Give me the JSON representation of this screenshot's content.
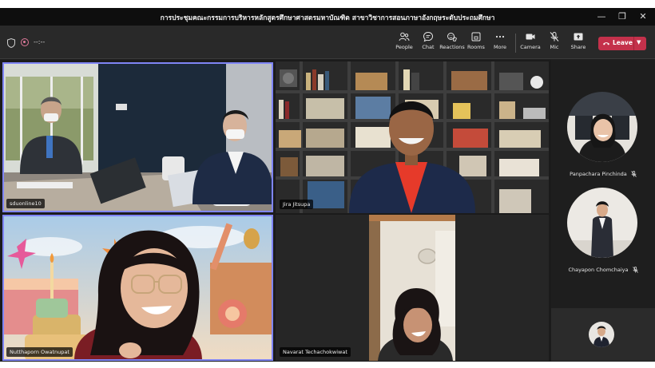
{
  "window": {
    "title": "การประชุมคณะกรรมการบริหารหลักสูตรศึกษาศาสตรมหาบัณฑิต สาขาวิชาการสอนภาษาอังกฤษระดับประถมศึกษา",
    "controls": {
      "minimize": "—",
      "maximize": "❐",
      "close": "✕"
    }
  },
  "toolbar": {
    "timer": "--:--",
    "buttons": [
      {
        "label": "People",
        "icon": "people-icon"
      },
      {
        "label": "Chat",
        "icon": "chat-icon"
      },
      {
        "label": "Reactions",
        "icon": "reactions-icon"
      },
      {
        "label": "Rooms",
        "icon": "rooms-icon"
      },
      {
        "label": "More",
        "icon": "more-icon"
      },
      {
        "label": "Camera",
        "icon": "camera-icon"
      },
      {
        "label": "Mic",
        "icon": "mic-off-icon"
      },
      {
        "label": "Share",
        "icon": "share-icon"
      }
    ],
    "leave_label": "Leave",
    "accent": "#c4314b"
  },
  "participants": {
    "video": [
      {
        "name": "sduonline10"
      },
      {
        "name": "Jira Jitsupa"
      },
      {
        "name": "Nutthaporn Owatnupat"
      },
      {
        "name": "Navarat Techachokwiwat"
      }
    ],
    "gallery": [
      {
        "name": "Panpachara Pinchinda",
        "muted": true
      },
      {
        "name": "Chayapon Chomchaiya",
        "muted": true
      }
    ]
  },
  "colors": {
    "selected_outline": "#7f85f5",
    "background": "#1f1f1f"
  }
}
